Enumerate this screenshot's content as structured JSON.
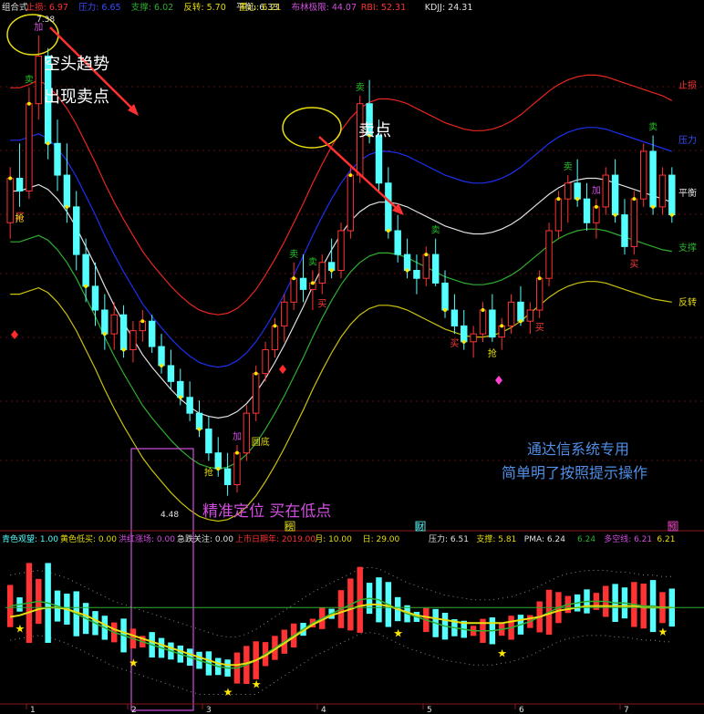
{
  "colors": {
    "bg": "#000000",
    "up": "#ff3333",
    "down": "#54ffff",
    "stop": "#e8261f",
    "pressure": "#1e2ff0",
    "balance": "#e0e0e0",
    "support": "#2fae2f",
    "reverse": "#c9c20e",
    "magenta": "#d24ee0",
    "annotWhite": "#ffffff",
    "annotBlue": "#4f8fe8",
    "grid": "#8b1a1a",
    "sell_marker": "#27c227",
    "buy_marker": "#ff3c3c"
  },
  "top_header": {
    "items": [
      {
        "label": "组合式",
        "color": "#e0e0e0"
      },
      {
        "label": "止损: 6.97",
        "color": "#ff3333"
      },
      {
        "label": "压力: 6.65",
        "color": "#3a4cff"
      },
      {
        "label": "支撑: 6.02",
        "color": "#2fae2f"
      },
      {
        "label": "反转: 5.70",
        "color": "#e6de10"
      },
      {
        "label": "平衡: 6.33",
        "color": "#e0e0e0"
      },
      {
        "label": "重心: 6.21",
        "color": "#e6de10"
      },
      {
        "label": "布林极限: 44.07",
        "color": "#d24ee0"
      },
      {
        "label": "RBI: 52.31",
        "color": "#ff3333"
      },
      {
        "label": "KDJJ: 24.31",
        "color": "#e0e0e0"
      }
    ]
  },
  "right_labels": [
    {
      "label": "止损",
      "color": "#ff3333"
    },
    {
      "label": "压力",
      "color": "#3a4cff"
    },
    {
      "label": "平衡",
      "color": "#e0e0e0"
    },
    {
      "label": "支撑",
      "color": "#2fae2f"
    },
    {
      "label": "反转",
      "color": "#e6de10"
    }
  ],
  "annotations": {
    "bear_trend": "空头趋势",
    "sell_signal": "出现卖点",
    "sell_point": "卖点",
    "precise": "精准定位 买在低点",
    "tdx_only": "通达信系统专用",
    "simple": "简单明了按照提示操作"
  },
  "price_labels": {
    "high": "7.38",
    "low": "4.48"
  },
  "signal_texts": {
    "sell": "卖",
    "buy": "买",
    "grab": "抢",
    "add": "加",
    "bottom": "圆底"
  },
  "event_markers": [
    "榜",
    "财",
    "预"
  ],
  "sub_header": {
    "items": [
      {
        "label": "青色观望: 1.00",
        "color": "#54ffff"
      },
      {
        "label": "黄色低买: 0.00",
        "color": "#e6de10"
      },
      {
        "label": "洪红涨场: 0.00",
        "color": "#d24ee0"
      },
      {
        "label": "急跌关注: 0.00",
        "color": "#e0e0e0"
      },
      {
        "label": "上市日期年: 2019.00",
        "color": "#ff3333"
      },
      {
        "label": "月: 10.00",
        "color": "#e6de10"
      },
      {
        "label": "日: 29.00",
        "color": "#e6de10"
      },
      {
        "label": "压力: 6.51",
        "color": "#e0e0e0"
      },
      {
        "label": "支撑: 5.81",
        "color": "#e6de10"
      },
      {
        "label": "PMA: 6.24",
        "color": "#e0e0e0"
      },
      {
        "label": "6.24",
        "color": "#2fae2f"
      },
      {
        "label": "多空线: 6.21",
        "color": "#d24ee0"
      },
      {
        "label": "6.21",
        "color": "#e6de10"
      }
    ]
  },
  "x_axis_labels": [
    "1",
    "2",
    "3",
    "4",
    "5",
    "6",
    "7"
  ],
  "chart_data": {
    "type": "candlestick",
    "title": "",
    "ylim": [
      4.3,
      7.5
    ],
    "candles": [
      [
        6.2,
        6.55,
        6.1,
        6.48
      ],
      [
        6.48,
        6.7,
        6.3,
        6.4
      ],
      [
        6.4,
        7.05,
        6.35,
        6.95
      ],
      [
        6.95,
        7.38,
        6.85,
        7.25
      ],
      [
        7.25,
        7.3,
        6.6,
        6.7
      ],
      [
        6.7,
        6.85,
        6.4,
        6.5
      ],
      [
        6.5,
        6.7,
        6.2,
        6.3
      ],
      [
        6.3,
        6.4,
        5.9,
        6.0
      ],
      [
        6.0,
        6.1,
        5.7,
        5.8
      ],
      [
        5.8,
        5.95,
        5.55,
        5.65
      ],
      [
        5.65,
        5.75,
        5.4,
        5.5
      ],
      [
        5.5,
        5.7,
        5.4,
        5.62
      ],
      [
        5.62,
        5.68,
        5.35,
        5.4
      ],
      [
        5.4,
        5.58,
        5.32,
        5.52
      ],
      [
        5.52,
        5.65,
        5.45,
        5.58
      ],
      [
        5.58,
        5.62,
        5.38,
        5.42
      ],
      [
        5.42,
        5.5,
        5.25,
        5.3
      ],
      [
        5.3,
        5.4,
        5.15,
        5.2
      ],
      [
        5.2,
        5.28,
        5.05,
        5.1
      ],
      [
        5.1,
        5.2,
        4.95,
        5.0
      ],
      [
        5.0,
        5.08,
        4.85,
        4.9
      ],
      [
        4.9,
        4.98,
        4.7,
        4.75
      ],
      [
        4.75,
        4.85,
        4.6,
        4.65
      ],
      [
        4.65,
        4.75,
        4.48,
        4.55
      ],
      [
        4.55,
        4.8,
        4.5,
        4.75
      ],
      [
        4.75,
        5.05,
        4.7,
        5.0
      ],
      [
        5.0,
        5.3,
        4.95,
        5.25
      ],
      [
        5.25,
        5.45,
        5.2,
        5.4
      ],
      [
        5.4,
        5.6,
        5.35,
        5.55
      ],
      [
        5.55,
        5.75,
        5.45,
        5.7
      ],
      [
        5.7,
        5.95,
        5.65,
        5.85
      ],
      [
        5.85,
        6.0,
        5.7,
        5.78
      ],
      [
        5.78,
        5.9,
        5.65,
        5.82
      ],
      [
        5.82,
        6.0,
        5.75,
        5.95
      ],
      [
        5.95,
        6.1,
        5.85,
        5.9
      ],
      [
        5.9,
        6.2,
        5.85,
        6.15
      ],
      [
        6.15,
        6.55,
        6.1,
        6.5
      ],
      [
        6.5,
        7.0,
        6.45,
        6.95
      ],
      [
        6.95,
        7.1,
        6.7,
        6.75
      ],
      [
        6.75,
        6.85,
        6.4,
        6.45
      ],
      [
        6.45,
        6.55,
        6.1,
        6.15
      ],
      [
        6.15,
        6.25,
        5.95,
        6.0
      ],
      [
        6.0,
        6.1,
        5.85,
        5.9
      ],
      [
        5.9,
        6.0,
        5.75,
        5.85
      ],
      [
        5.85,
        6.05,
        5.8,
        6.0
      ],
      [
        6.0,
        6.1,
        5.8,
        5.82
      ],
      [
        5.82,
        5.9,
        5.6,
        5.65
      ],
      [
        5.65,
        5.75,
        5.5,
        5.55
      ],
      [
        5.55,
        5.65,
        5.4,
        5.45
      ],
      [
        5.45,
        5.55,
        5.35,
        5.5
      ],
      [
        5.5,
        5.7,
        5.45,
        5.65
      ],
      [
        5.65,
        5.75,
        5.45,
        5.48
      ],
      [
        5.48,
        5.6,
        5.4,
        5.55
      ],
      [
        5.55,
        5.75,
        5.5,
        5.7
      ],
      [
        5.7,
        5.8,
        5.55,
        5.58
      ],
      [
        5.58,
        5.7,
        5.5,
        5.65
      ],
      [
        5.65,
        5.9,
        5.6,
        5.85
      ],
      [
        5.85,
        6.2,
        5.8,
        6.15
      ],
      [
        6.15,
        6.4,
        6.1,
        6.35
      ],
      [
        6.35,
        6.5,
        6.2,
        6.45
      ],
      [
        6.45,
        6.6,
        6.3,
        6.35
      ],
      [
        6.35,
        6.45,
        6.15,
        6.2
      ],
      [
        6.2,
        6.35,
        6.1,
        6.3
      ],
      [
        6.3,
        6.55,
        6.25,
        6.5
      ],
      [
        6.5,
        6.6,
        6.2,
        6.25
      ],
      [
        6.25,
        6.35,
        6.0,
        6.05
      ],
      [
        6.05,
        6.4,
        6.0,
        6.35
      ],
      [
        6.35,
        6.7,
        6.3,
        6.65
      ],
      [
        6.65,
        6.75,
        6.25,
        6.3
      ],
      [
        6.3,
        6.55,
        6.25,
        6.5
      ],
      [
        6.5,
        6.55,
        6.2,
        6.25
      ]
    ],
    "series": [
      {
        "name": "止损",
        "color": "#e8261f",
        "values": [
          7.05,
          7.05,
          7.07,
          7.1,
          7.06,
          7.0,
          6.92,
          6.82,
          6.7,
          6.58,
          6.45,
          6.33,
          6.22,
          6.12,
          6.02,
          5.94,
          5.87,
          5.8,
          5.74,
          5.69,
          5.65,
          5.63,
          5.62,
          5.63,
          5.66,
          5.71,
          5.78,
          5.87,
          5.97,
          6.08,
          6.2,
          6.32,
          6.45,
          6.57,
          6.68,
          6.78,
          6.86,
          6.92,
          6.96,
          6.98,
          6.98,
          6.97,
          6.95,
          6.92,
          6.89,
          6.86,
          6.83,
          6.81,
          6.79,
          6.78,
          6.78,
          6.79,
          6.81,
          6.84,
          6.88,
          6.93,
          6.98,
          7.03,
          7.07,
          7.1,
          7.12,
          7.13,
          7.13,
          7.12,
          7.1,
          7.08,
          7.06,
          7.04,
          7.02,
          7.0,
          6.97
        ]
      },
      {
        "name": "压力",
        "color": "#1e2ff0",
        "values": [
          6.72,
          6.72,
          6.74,
          6.76,
          6.73,
          6.67,
          6.59,
          6.49,
          6.37,
          6.25,
          6.12,
          6.0,
          5.89,
          5.79,
          5.69,
          5.61,
          5.54,
          5.47,
          5.41,
          5.36,
          5.32,
          5.3,
          5.29,
          5.3,
          5.33,
          5.38,
          5.45,
          5.54,
          5.64,
          5.75,
          5.87,
          5.99,
          6.12,
          6.24,
          6.35,
          6.45,
          6.53,
          6.59,
          6.63,
          6.65,
          6.65,
          6.64,
          6.62,
          6.59,
          6.56,
          6.53,
          6.5,
          6.48,
          6.46,
          6.45,
          6.45,
          6.46,
          6.48,
          6.51,
          6.55,
          6.6,
          6.65,
          6.7,
          6.74,
          6.77,
          6.79,
          6.8,
          6.8,
          6.79,
          6.77,
          6.75,
          6.73,
          6.71,
          6.69,
          6.67,
          6.65
        ]
      },
      {
        "name": "平衡",
        "color": "#e0e0e0",
        "values": [
          6.4,
          6.4,
          6.42,
          6.44,
          6.41,
          6.35,
          6.27,
          6.17,
          6.05,
          5.93,
          5.8,
          5.68,
          5.57,
          5.47,
          5.37,
          5.29,
          5.22,
          5.15,
          5.09,
          5.04,
          5.0,
          4.98,
          4.97,
          4.98,
          5.01,
          5.06,
          5.13,
          5.22,
          5.32,
          5.43,
          5.55,
          5.67,
          5.8,
          5.92,
          6.03,
          6.13,
          6.21,
          6.27,
          6.31,
          6.33,
          6.33,
          6.32,
          6.3,
          6.27,
          6.24,
          6.21,
          6.18,
          6.16,
          6.14,
          6.13,
          6.13,
          6.14,
          6.16,
          6.19,
          6.23,
          6.28,
          6.33,
          6.38,
          6.42,
          6.45,
          6.47,
          6.48,
          6.48,
          6.47,
          6.45,
          6.43,
          6.41,
          6.39,
          6.37,
          6.35,
          6.33
        ]
      },
      {
        "name": "支撑",
        "color": "#2fae2f",
        "values": [
          6.08,
          6.08,
          6.1,
          6.12,
          6.09,
          6.03,
          5.95,
          5.85,
          5.73,
          5.61,
          5.48,
          5.36,
          5.25,
          5.15,
          5.05,
          4.97,
          4.9,
          4.83,
          4.77,
          4.72,
          4.68,
          4.66,
          4.65,
          4.66,
          4.69,
          4.74,
          4.81,
          4.9,
          5.0,
          5.11,
          5.23,
          5.35,
          5.48,
          5.6,
          5.71,
          5.81,
          5.89,
          5.95,
          5.99,
          6.01,
          6.01,
          6.0,
          5.98,
          5.95,
          5.92,
          5.89,
          5.86,
          5.84,
          5.82,
          5.81,
          5.81,
          5.82,
          5.84,
          5.87,
          5.91,
          5.96,
          6.01,
          6.06,
          6.1,
          6.13,
          6.15,
          6.16,
          6.16,
          6.15,
          6.13,
          6.11,
          6.09,
          6.07,
          6.05,
          6.03,
          6.02
        ]
      },
      {
        "name": "反转",
        "color": "#c9c20e",
        "values": [
          5.75,
          5.75,
          5.77,
          5.79,
          5.76,
          5.7,
          5.62,
          5.52,
          5.4,
          5.28,
          5.15,
          5.03,
          4.92,
          4.82,
          4.72,
          4.64,
          4.57,
          4.5,
          4.44,
          4.39,
          4.35,
          4.33,
          4.32,
          4.33,
          4.36,
          4.41,
          4.48,
          4.57,
          4.67,
          4.78,
          4.9,
          5.02,
          5.15,
          5.27,
          5.38,
          5.48,
          5.56,
          5.62,
          5.66,
          5.68,
          5.68,
          5.67,
          5.65,
          5.62,
          5.59,
          5.56,
          5.53,
          5.51,
          5.49,
          5.48,
          5.48,
          5.49,
          5.51,
          5.54,
          5.58,
          5.63,
          5.68,
          5.73,
          5.77,
          5.8,
          5.82,
          5.83,
          5.83,
          5.82,
          5.8,
          5.78,
          5.76,
          5.74,
          5.72,
          5.71,
          5.7
        ]
      }
    ],
    "signals": [
      {
        "i": 2,
        "type": "sell"
      },
      {
        "i": 3,
        "type": "add"
      },
      {
        "i": 1,
        "type": "buy"
      },
      {
        "i": 1,
        "type": "grab"
      },
      {
        "i": 21,
        "type": "grab"
      },
      {
        "i": 24,
        "type": "add"
      },
      {
        "i": 26,
        "type": "bottom"
      },
      {
        "i": 30,
        "type": "sell"
      },
      {
        "i": 32,
        "type": "sell"
      },
      {
        "i": 37,
        "type": "sell"
      },
      {
        "i": 33,
        "type": "buy"
      },
      {
        "i": 45,
        "type": "sell"
      },
      {
        "i": 47,
        "type": "buy"
      },
      {
        "i": 51,
        "type": "grab"
      },
      {
        "i": 56,
        "type": "buy"
      },
      {
        "i": 59,
        "type": "sell"
      },
      {
        "i": 62,
        "type": "add"
      },
      {
        "i": 68,
        "type": "sell"
      },
      {
        "i": 66,
        "type": "buy"
      }
    ],
    "sub_chart": {
      "pma": [
        0.62,
        0.63,
        0.64,
        0.65,
        0.64,
        0.62,
        0.6,
        0.57,
        0.54,
        0.51,
        0.48,
        0.45,
        0.43,
        0.41,
        0.39,
        0.37,
        0.35,
        0.33,
        0.31,
        0.29,
        0.27,
        0.25,
        0.23,
        0.22,
        0.22,
        0.24,
        0.27,
        0.31,
        0.35,
        0.39,
        0.43,
        0.47,
        0.51,
        0.54,
        0.57,
        0.6,
        0.63,
        0.66,
        0.67,
        0.66,
        0.63,
        0.6,
        0.57,
        0.55,
        0.53,
        0.51,
        0.49,
        0.48,
        0.47,
        0.46,
        0.46,
        0.46,
        0.47,
        0.48,
        0.5,
        0.52,
        0.55,
        0.58,
        0.61,
        0.63,
        0.64,
        0.65,
        0.65,
        0.65,
        0.64,
        0.64,
        0.63,
        0.62,
        0.62,
        0.61,
        0.61
      ],
      "yellow": [
        0.55,
        0.56,
        0.58,
        0.6,
        0.61,
        0.61,
        0.6,
        0.58,
        0.56,
        0.53,
        0.5,
        0.47,
        0.45,
        0.43,
        0.41,
        0.39,
        0.37,
        0.35,
        0.33,
        0.31,
        0.29,
        0.27,
        0.25,
        0.24,
        0.24,
        0.25,
        0.27,
        0.3,
        0.34,
        0.38,
        0.42,
        0.46,
        0.5,
        0.53,
        0.56,
        0.58,
        0.6,
        0.62,
        0.63,
        0.63,
        0.62,
        0.6,
        0.58,
        0.56,
        0.55,
        0.54,
        0.53,
        0.52,
        0.51,
        0.51,
        0.51,
        0.51,
        0.51,
        0.52,
        0.53,
        0.54,
        0.55,
        0.57,
        0.59,
        0.6,
        0.61,
        0.62,
        0.62,
        0.62,
        0.62,
        0.62,
        0.62,
        0.61,
        0.61,
        0.61,
        0.61
      ],
      "stars": [
        1,
        13,
        23,
        26,
        41,
        52,
        69
      ]
    }
  }
}
